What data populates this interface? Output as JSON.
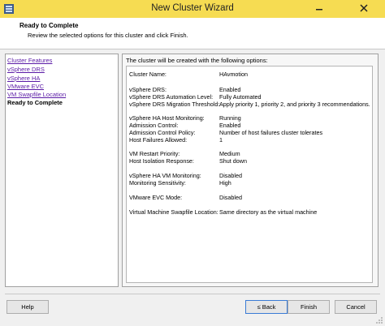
{
  "window": {
    "title": "New Cluster Wizard"
  },
  "header": {
    "title": "Ready to Complete",
    "subtitle": "Review the selected options for this cluster and click Finish."
  },
  "nav": {
    "items": [
      {
        "label": "Cluster Features"
      },
      {
        "label": "vSphere DRS"
      },
      {
        "label": "vSphere HA"
      },
      {
        "label": "VMware EVC"
      },
      {
        "label": "VM Swapfile Location"
      },
      {
        "label": "Ready to Complete"
      }
    ]
  },
  "summary": {
    "heading": "The cluster will be created with the following options:",
    "rows": [
      {
        "label": "Cluster Name:",
        "value": "HAvmotion"
      },
      {
        "label": "vSphere DRS:",
        "value": "Enabled"
      },
      {
        "label": "vSphere DRS Automation Level:",
        "value": "Fully Automated"
      },
      {
        "label": "vSphere DRS Migration Threshold:",
        "value": "Apply priority 1, priority 2, and priority 3 recommendations."
      },
      {
        "label": "vSphere HA Host Monitoring:",
        "value": "Running"
      },
      {
        "label": "Admission Control:",
        "value": "Enabled"
      },
      {
        "label": "Admission Control Policy:",
        "value": "Number of host failures cluster tolerates"
      },
      {
        "label": "Host Failures Allowed:",
        "value": "1"
      },
      {
        "label": "VM Restart Priority:",
        "value": "Medium"
      },
      {
        "label": "Host Isolation Response:",
        "value": "Shut down"
      },
      {
        "label": "vSphere HA VM Monitoring:",
        "value": "Disabled"
      },
      {
        "label": "Monitoring Sensitivity:",
        "value": "High"
      },
      {
        "label": "VMware EVC Mode:",
        "value": "Disabled"
      },
      {
        "label": "Virtual Machine Swapfile Location:",
        "value": "Same directory as the virtual machine"
      }
    ]
  },
  "buttons": {
    "help": "Help",
    "back": "≤ Back",
    "finish": "Finish",
    "cancel": "Cancel"
  },
  "colors": {
    "titlebar": "#f6dc52",
    "link": "#5a1aa6"
  }
}
